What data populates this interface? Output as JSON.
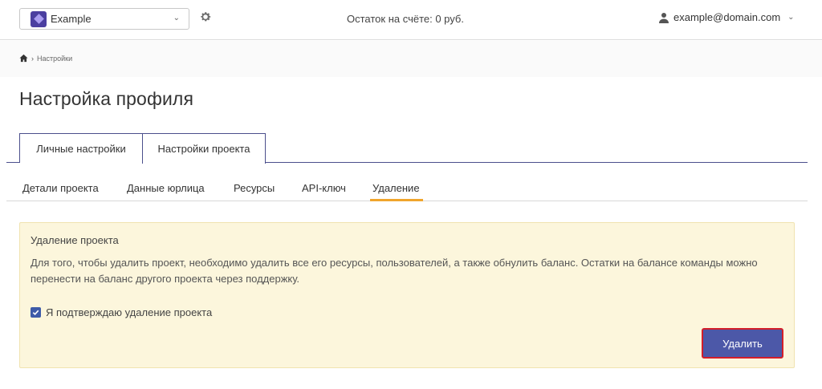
{
  "header": {
    "project_select": {
      "value": "Example",
      "logo_icon": "project-diamond-icon"
    },
    "settings_icon": "gear-icon",
    "balance": "Остаток на счёте: 0 руб.",
    "user": {
      "icon": "user-icon",
      "email": "example@domain.com"
    }
  },
  "breadcrumb": {
    "home_icon": "home-icon",
    "current": "Настройки"
  },
  "page_title": "Настройка профиля",
  "main_tabs": [
    {
      "label": "Личные настройки",
      "active": false
    },
    {
      "label": "Настройки проекта",
      "active": true
    }
  ],
  "sub_tabs": [
    {
      "label": "Детали проекта",
      "active": false
    },
    {
      "label": "Данные юрлица",
      "active": false
    },
    {
      "label": "Ресурсы",
      "active": false
    },
    {
      "label": "API-ключ",
      "active": false
    },
    {
      "label": "Удаление",
      "active": true
    }
  ],
  "delete_panel": {
    "title": "Удаление проекта",
    "text": "Для того, чтобы удалить проект, необходимо удалить все его ресурсы, пользователей, а также обнулить баланс. Остатки на балансе команды можно перенести на баланс другого проекта через поддержку.",
    "confirm_label": "Я подтверждаю удаление проекта",
    "confirm_checked": true,
    "delete_button": "Удалить"
  },
  "colors": {
    "accent": "#4c58a8",
    "tab_underline": "#f0a52c",
    "panel_bg": "#fcf6dc",
    "highlight_border": "#d31e2a"
  }
}
